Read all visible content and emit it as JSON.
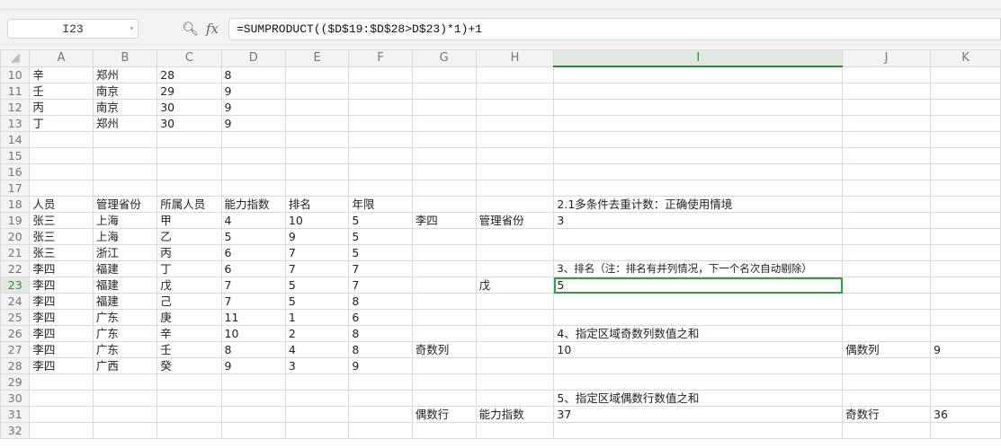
{
  "name_box": "I23",
  "formula": "=SUMPRODUCT(($D$19:$D$28>D$23)*1)+1",
  "columns": [
    "A",
    "B",
    "C",
    "D",
    "E",
    "F",
    "G",
    "H",
    "I",
    "J",
    "K"
  ],
  "selected_column": "I",
  "selected_row": "23",
  "rows": [
    {
      "n": "10",
      "c": [
        "辛",
        "郑州",
        "28",
        "8",
        "",
        "",
        "",
        "",
        "",
        "",
        ""
      ]
    },
    {
      "n": "11",
      "c": [
        "壬",
        "南京",
        "29",
        "9",
        "",
        "",
        "",
        "",
        "",
        "",
        ""
      ]
    },
    {
      "n": "12",
      "c": [
        "丙",
        "南京",
        "30",
        "9",
        "",
        "",
        "",
        "",
        "",
        "",
        ""
      ]
    },
    {
      "n": "13",
      "c": [
        "丁",
        "郑州",
        "30",
        "9",
        "",
        "",
        "",
        "",
        "",
        "",
        ""
      ]
    },
    {
      "n": "14",
      "c": [
        "",
        "",
        "",
        "",
        "",
        "",
        "",
        "",
        "",
        "",
        ""
      ]
    },
    {
      "n": "15",
      "c": [
        "",
        "",
        "",
        "",
        "",
        "",
        "",
        "",
        "",
        "",
        ""
      ]
    },
    {
      "n": "16",
      "c": [
        "",
        "",
        "",
        "",
        "",
        "",
        "",
        "",
        "",
        "",
        ""
      ]
    },
    {
      "n": "17",
      "c": [
        "",
        "",
        "",
        "",
        "",
        "",
        "",
        "",
        "",
        "",
        ""
      ]
    },
    {
      "n": "18",
      "c": [
        "人员",
        "管理省份",
        "所属人员",
        "能力指数",
        "排名",
        "年限",
        "",
        "",
        "2.1多条件去重计数：正确使用情境",
        "",
        ""
      ]
    },
    {
      "n": "19",
      "c": [
        "张三",
        "上海",
        "甲",
        "4",
        "10",
        "5",
        "李四",
        "管理省份",
        "3",
        "",
        ""
      ]
    },
    {
      "n": "20",
      "c": [
        "张三",
        "上海",
        "乙",
        "5",
        "9",
        "5",
        "",
        "",
        "",
        "",
        ""
      ]
    },
    {
      "n": "21",
      "c": [
        "张三",
        "浙江",
        "丙",
        "6",
        "7",
        "5",
        "",
        "",
        "",
        "",
        ""
      ]
    },
    {
      "n": "22",
      "c": [
        "李四",
        "福建",
        "丁",
        "6",
        "7",
        "7",
        "",
        "",
        "3、排名（注：排名有并列情况，下一个名次自动剔除）",
        "",
        ""
      ]
    },
    {
      "n": "23",
      "c": [
        "李四",
        "福建",
        "戊",
        "7",
        "5",
        "7",
        "",
        "戊",
        "5",
        "",
        ""
      ]
    },
    {
      "n": "24",
      "c": [
        "李四",
        "福建",
        "己",
        "7",
        "5",
        "8",
        "",
        "",
        "",
        "",
        ""
      ]
    },
    {
      "n": "25",
      "c": [
        "李四",
        "广东",
        "庚",
        "11",
        "1",
        "6",
        "",
        "",
        "",
        "",
        ""
      ]
    },
    {
      "n": "26",
      "c": [
        "李四",
        "广东",
        "辛",
        "10",
        "2",
        "8",
        "",
        "",
        "4、指定区域奇数列数值之和",
        "",
        ""
      ]
    },
    {
      "n": "27",
      "c": [
        "李四",
        "广东",
        "壬",
        "8",
        "4",
        "8",
        "奇数列",
        "",
        "10",
        "偶数列",
        "9"
      ]
    },
    {
      "n": "28",
      "c": [
        "李四",
        "广西",
        "癸",
        "9",
        "3",
        "9",
        "",
        "",
        "",
        "",
        ""
      ]
    },
    {
      "n": "29",
      "c": [
        "",
        "",
        "",
        "",
        "",
        "",
        "",
        "",
        "",
        "",
        ""
      ]
    },
    {
      "n": "30",
      "c": [
        "",
        "",
        "",
        "",
        "",
        "",
        "",
        "",
        "5、指定区域偶数行数值之和",
        "",
        ""
      ]
    },
    {
      "n": "31",
      "c": [
        "",
        "",
        "",
        "",
        "",
        "",
        "偶数行",
        "能力指数",
        "37",
        "奇数行",
        "36"
      ]
    },
    {
      "n": "32",
      "c": [
        "",
        "",
        "",
        "",
        "",
        "",
        "",
        "",
        "",
        "",
        ""
      ]
    }
  ]
}
